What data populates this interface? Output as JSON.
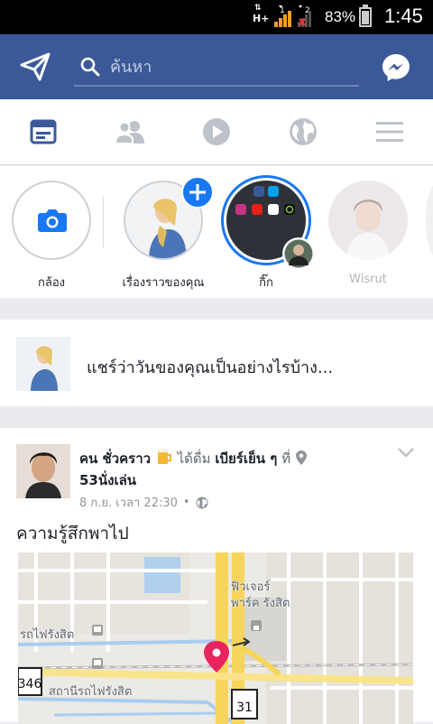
{
  "statusbar": {
    "network": "H+",
    "sim1": "1",
    "sim2": "2",
    "battery": "83%",
    "time": "1:45"
  },
  "header": {
    "search_placeholder": "ค้นหา"
  },
  "tabs": [
    {
      "icon": "news-feed-icon",
      "active": true
    },
    {
      "icon": "friends-icon",
      "active": false
    },
    {
      "icon": "watch-icon",
      "active": false
    },
    {
      "icon": "notifications-globe-icon",
      "active": false
    },
    {
      "icon": "menu-icon",
      "active": false
    }
  ],
  "stories": [
    {
      "label": "กล้อง"
    },
    {
      "label": "เรื่องราวของคุณ"
    },
    {
      "label": "กิ๊ก"
    },
    {
      "label": "Wisrut"
    }
  ],
  "composer": {
    "prompt": "แชร์ว่าวันของคุณเป็นอย่างไรบ้าง..."
  },
  "post": {
    "author": "คน ชั่วคราว",
    "action_text": "ได้ดื่ม",
    "drink": "เบียร์เย็น ๆ",
    "at_text": "ที่",
    "place": "53นั่งเล่น",
    "timestamp": "8 ก.ย. เวลา 22:30",
    "dot": "•",
    "body": "ความรู้สึกพาไป",
    "map": {
      "label_future_park": "ฟิวเจอร์\nพาร์ค รังสิต",
      "label_rail_top": "รถไฟรังสิต",
      "label_station": "สถานีรถไฟรังสิต",
      "road_346": "346",
      "road_31": "31"
    }
  },
  "colors": {
    "brand": "#3b5998",
    "accent": "#1877f2",
    "pin": "#e7245e"
  }
}
